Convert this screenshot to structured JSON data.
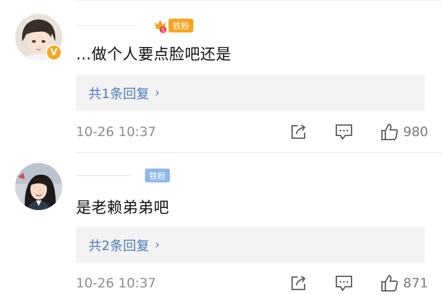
{
  "comments": [
    {
      "fan_badge": "铁粉",
      "fan_level": "5",
      "verified": "V",
      "text": "…做个人要点脸吧还是",
      "reply_label": "共1条回复",
      "time": "10-26 10:37",
      "likes": "980"
    },
    {
      "fan_badge": "铁粉",
      "text": "是老赖弟弟吧",
      "reply_label": "共2条回复",
      "time": "10-26 10:37",
      "likes": "871"
    }
  ],
  "icons": {
    "reply_chevron": "›",
    "share": "share-icon",
    "comment": "comment-icon",
    "like": "thumbs-up-icon"
  },
  "colors": {
    "link_blue": "#4b7bbf",
    "badge_orange": "#f6a623",
    "badge_blue": "#8db8e8",
    "muted_gray": "#8c8c8c"
  }
}
